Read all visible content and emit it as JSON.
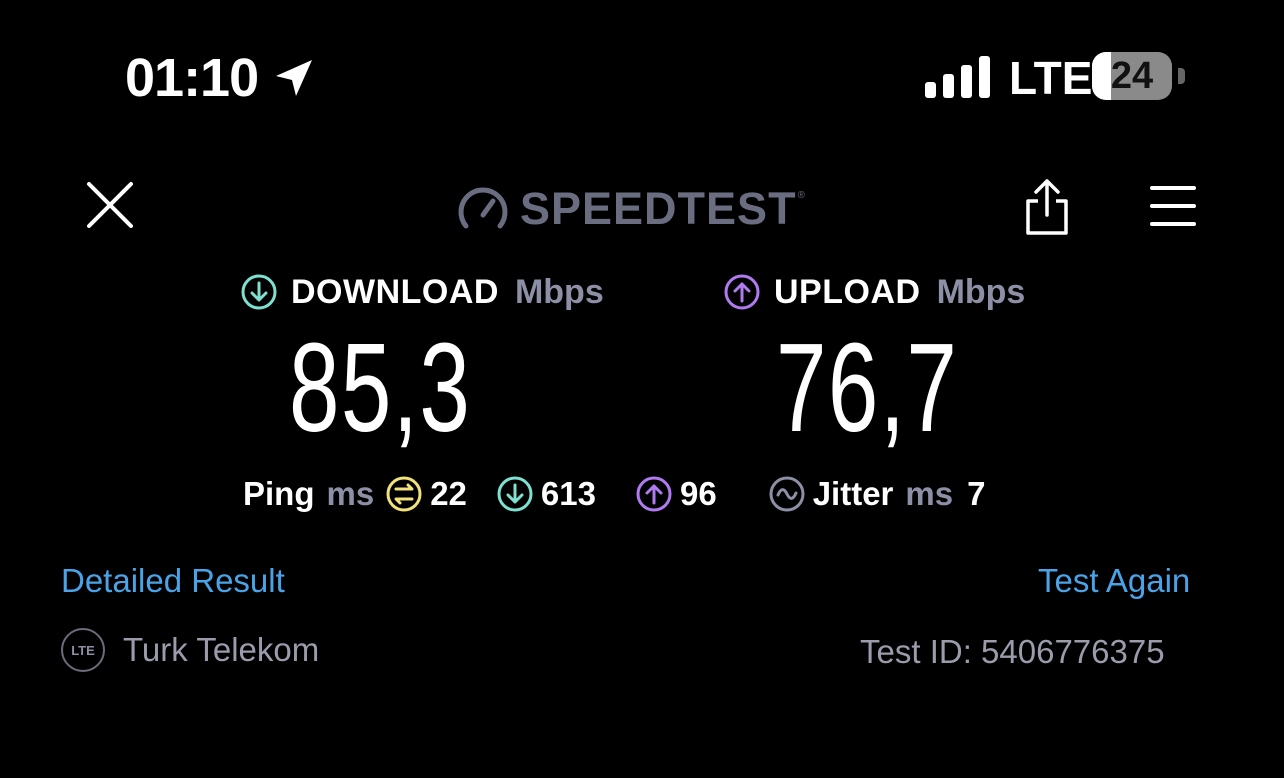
{
  "status_bar": {
    "time": "01:10",
    "network": "LTE",
    "battery": "24",
    "battery_level": 0.24
  },
  "header": {
    "logo_text": "SPEEDTEST",
    "logo_tm": "®"
  },
  "download": {
    "title": "DOWNLOAD",
    "unit": "Mbps",
    "value": "85,3",
    "color": "#7ee0cf"
  },
  "upload": {
    "title": "UPLOAD",
    "unit": "Mbps",
    "value": "76,7",
    "color": "#b07af0"
  },
  "ping": {
    "label": "Ping",
    "unit": "ms",
    "idle": "22",
    "idle_color": "#f2e27a",
    "download": "613",
    "upload": "96"
  },
  "jitter": {
    "label": "Jitter",
    "unit": "ms",
    "value": "7",
    "color": "#8d8fa6"
  },
  "actions": {
    "detailed": "Detailed Result",
    "again": "Test Again"
  },
  "connection": {
    "badge": "LTE",
    "isp": "Turk Telekom",
    "test_id": "Test ID: 5406776375"
  },
  "icons": [
    "location-arrow-icon",
    "signal-icon",
    "battery-icon",
    "close-icon",
    "speedometer-icon",
    "share-icon",
    "menu-icon",
    "download-arrow-icon",
    "upload-arrow-icon",
    "ping-idle-icon",
    "jitter-icon",
    "lte-icon"
  ]
}
